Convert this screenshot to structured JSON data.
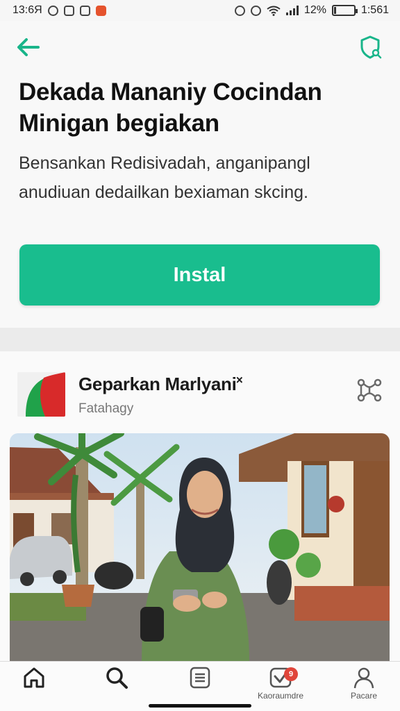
{
  "status_bar": {
    "time": "13:6Я",
    "battery": "12%",
    "battery_level": 0.12,
    "clock_right": "1:561"
  },
  "header": {
    "back_icon": "arrow-left-icon",
    "shield_icon": "shield-search-icon",
    "accent_color": "#19bd8e"
  },
  "hero": {
    "title": "Dekada Mananiy Cocindan Minigan begiakan",
    "description": "Bensankan Redisivadah, anganipangl anudiuan dedailkan bexiaman skcing.",
    "install_label": "Instal"
  },
  "post": {
    "title": "Geparkan Marlyani˟",
    "subtitle": "Fatahagy",
    "share_icon": "share-network-icon"
  },
  "bottom_nav": {
    "items": [
      {
        "icon": "home-icon",
        "label": ""
      },
      {
        "icon": "search-icon",
        "label": ""
      },
      {
        "icon": "list-icon",
        "label": ""
      },
      {
        "icon": "check-badge-icon",
        "label": "Kaoraumdre",
        "badge": "9"
      },
      {
        "icon": "profile-icon",
        "label": "Pacare"
      }
    ]
  }
}
